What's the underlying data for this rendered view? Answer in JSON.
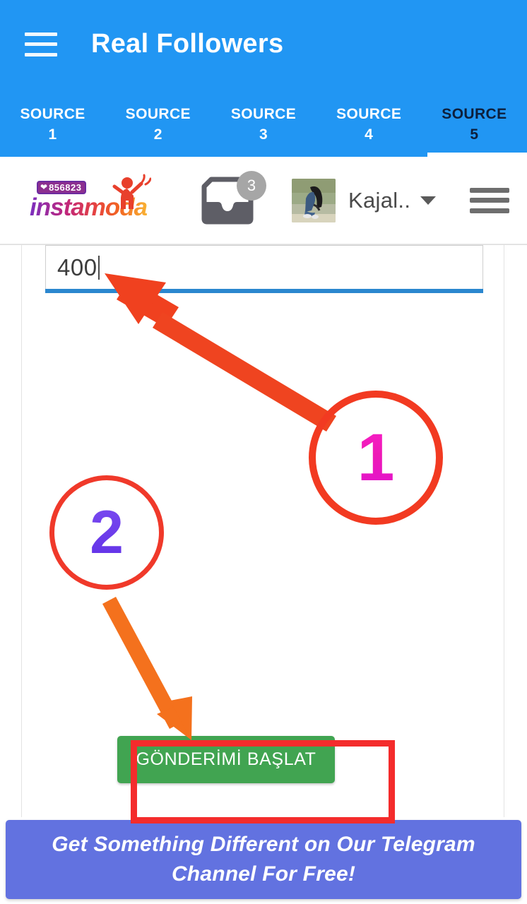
{
  "app": {
    "title": "Real Followers",
    "menu_icon": "hamburger-menu-icon",
    "accent_color": "#2196f3"
  },
  "tabs": [
    {
      "line1": "SOURCE",
      "line2": "1",
      "active": false
    },
    {
      "line1": "SOURCE",
      "line2": "2",
      "active": false
    },
    {
      "line1": "SOURCE",
      "line2": "3",
      "active": false
    },
    {
      "line1": "SOURCE",
      "line2": "4",
      "active": false
    },
    {
      "line1": "SOURCE",
      "line2": "5",
      "active": true
    }
  ],
  "site_header": {
    "logo": {
      "wordmark": "instamoda",
      "badge_count": "856823",
      "badge_heart_icon": "heart-icon",
      "figure_icon": "person-celebrating-icon"
    },
    "inbox": {
      "icon": "inbox-tray-icon",
      "badge_count": "3"
    },
    "user": {
      "avatar_icon": "user-avatar-photo",
      "name": "Kajal..",
      "caret_icon": "chevron-down-icon"
    },
    "menu_icon": "hamburger-menu-icon"
  },
  "form": {
    "amount_value": "400",
    "amount_placeholder": "",
    "submit_label": "GÖNDERİMİ BAŞLAT",
    "submit_color": "#41a451"
  },
  "banner": {
    "text": "Get Something Different on Our Telegram Channel For Free!",
    "color": "#6272e0"
  },
  "annotations": {
    "step1": {
      "number": "1",
      "circle_color": "#f23a21",
      "number_color": "#ee19b6",
      "arrow_color": "#f0411f",
      "points_to": "amount-input"
    },
    "step2": {
      "number": "2",
      "circle_color": "#f0392a",
      "number_color": "#6b3bea",
      "arrow_color": "#f4711d",
      "points_to": "submit-button"
    },
    "highlight_box_color": "#f42c2c"
  }
}
